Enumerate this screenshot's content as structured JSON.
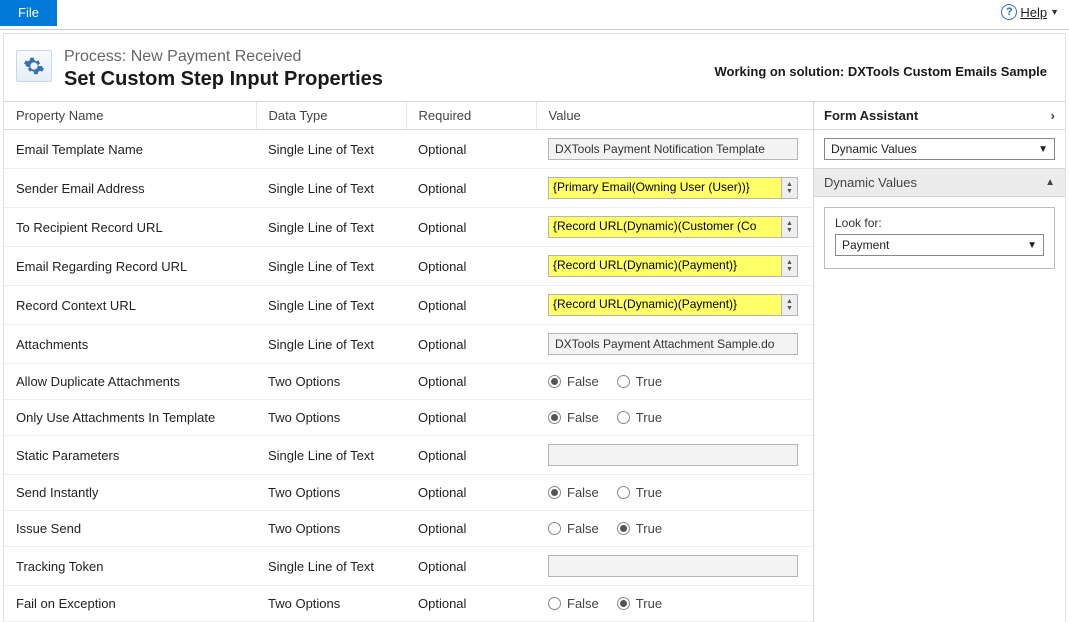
{
  "topbar": {
    "file_label": "File",
    "help_label": "Help"
  },
  "header": {
    "process_prefix": "Process: ",
    "process_name": "New Payment Received",
    "title": "Set Custom Step Input Properties",
    "solution_prefix": "Working on solution: ",
    "solution_name": "DXTools Custom Emails Sample"
  },
  "columns": {
    "name": "Property Name",
    "type": "Data Type",
    "required": "Required",
    "value": "Value"
  },
  "types": {
    "text": "Single Line of Text",
    "two": "Two Options"
  },
  "required": {
    "optional": "Optional"
  },
  "radio": {
    "false": "False",
    "true": "True"
  },
  "rows": {
    "email_template": {
      "name": "Email Template Name",
      "value": "DXTools Payment Notification Template"
    },
    "sender": {
      "name": "Sender Email Address",
      "value": "{Primary Email(Owning User (User))}"
    },
    "to_recipient": {
      "name": "To Recipient Record URL",
      "value": "{Record URL(Dynamic)(Customer (Co"
    },
    "regarding": {
      "name": "Email Regarding Record URL",
      "value": "{Record URL(Dynamic)(Payment)}"
    },
    "context": {
      "name": "Record Context URL",
      "value": "{Record URL(Dynamic)(Payment)}"
    },
    "attachments": {
      "name": "Attachments",
      "value": "DXTools Payment Attachment Sample.do"
    },
    "allow_dup": {
      "name": "Allow Duplicate Attachments",
      "selected": "False"
    },
    "only_template": {
      "name": "Only Use Attachments In Template",
      "selected": "False"
    },
    "static_params": {
      "name": "Static Parameters",
      "value": ""
    },
    "send_instantly": {
      "name": "Send Instantly",
      "selected": "False"
    },
    "issue_send": {
      "name": "Issue Send",
      "selected": "True"
    },
    "tracking": {
      "name": "Tracking Token",
      "value": ""
    },
    "fail_exception": {
      "name": "Fail on Exception",
      "selected": "True"
    }
  },
  "assistant": {
    "title": "Form Assistant",
    "dropdown": "Dynamic Values",
    "section": "Dynamic Values",
    "lookfor_label": "Look for:",
    "lookfor_value": "Payment"
  }
}
